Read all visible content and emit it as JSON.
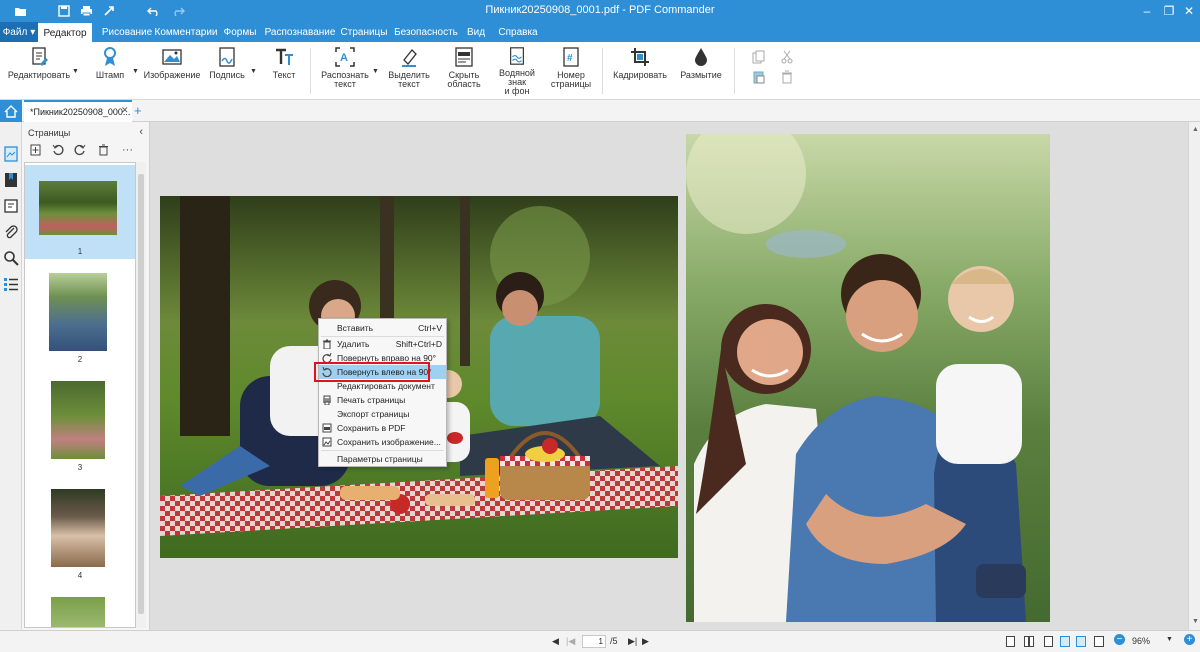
{
  "window": {
    "title": "Пикник20250908_0001.pdf - PDF Commander"
  },
  "menu": {
    "file_label": "Файл",
    "tabs": [
      "Редактор",
      "Рисование",
      "Комментарии",
      "Формы",
      "Распознавание",
      "Страницы",
      "Безопасность",
      "Вид",
      "Справка"
    ],
    "active_tab": "Редактор"
  },
  "ribbon": {
    "edit": "Редактировать",
    "stamp": "Штамп",
    "image": "Изображение",
    "signature": "Подпись",
    "text": "Текст",
    "recognize_l1": "Распознать",
    "recognize_l2": "текст",
    "select_l1": "Выделить",
    "select_l2": "текст",
    "hide_l1": "Скрыть",
    "hide_l2": "область",
    "watermark_l1": "Водяной знак",
    "watermark_l2": "и фон",
    "pagenum_l1": "Номер",
    "pagenum_l2": "страницы",
    "crop": "Кадрировать",
    "blur": "Размытие"
  },
  "doc_tab": {
    "label": "*Пикник20250908_000...",
    "close": "✕",
    "add": "+"
  },
  "pages_panel": {
    "title": "Страницы",
    "thumbnails": [
      {
        "number": "1",
        "selected": true
      },
      {
        "number": "2",
        "selected": false
      },
      {
        "number": "3",
        "selected": false
      },
      {
        "number": "4",
        "selected": false
      }
    ]
  },
  "context_menu": {
    "items": [
      {
        "label": "Вставить",
        "shortcut": "Ctrl+V"
      },
      {
        "label": "Удалить",
        "shortcut": "Shift+Ctrl+D"
      },
      {
        "label": "Повернуть вправо на 90°",
        "shortcut": ""
      },
      {
        "label": "Повернуть влево на 90°",
        "shortcut": ""
      },
      {
        "label": "Редактировать документ",
        "shortcut": ""
      },
      {
        "label": "Печать страницы",
        "shortcut": ""
      },
      {
        "label": "Экспорт страницы",
        "shortcut": ""
      },
      {
        "label": "Сохранить в PDF",
        "shortcut": ""
      },
      {
        "label": "Сохранить изображение...",
        "shortcut": ""
      },
      {
        "label": "Параметры страницы",
        "shortcut": ""
      }
    ],
    "highlighted": "Повернуть влево на 90°"
  },
  "status": {
    "current_page": "1",
    "total_pages": "/5",
    "zoom": "96%"
  },
  "colors": {
    "accent": "#2e8fd6",
    "highlight": "#9ed0f2",
    "annotation": "#e0151c"
  }
}
